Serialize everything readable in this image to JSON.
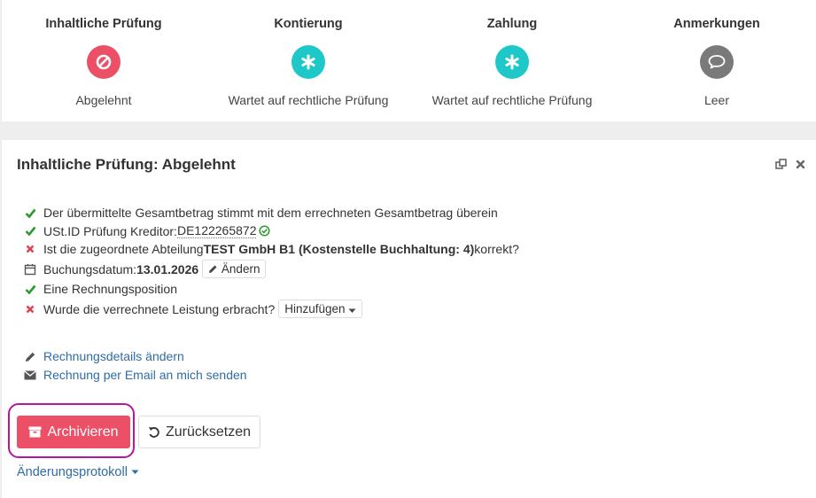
{
  "steps": [
    {
      "title": "Inhaltliche Prüfung",
      "status": "Abgelehnt",
      "icon": "ban-icon",
      "color": "#eb5066"
    },
    {
      "title": "Kontierung",
      "status": "Wartet auf rechtliche Prüfung",
      "icon": "asterisk-icon",
      "color": "#1fc8c8"
    },
    {
      "title": "Zahlung",
      "status": "Wartet auf rechtliche Prüfung",
      "icon": "asterisk-icon",
      "color": "#1fc8c8"
    },
    {
      "title": "Anmerkungen",
      "status": "Leer",
      "icon": "comment-icon",
      "color": "#7a7a7a"
    }
  ],
  "panel": {
    "title": "Inhaltliche Prüfung: Abgelehnt",
    "checks": {
      "total_match": "Der übermittelte Gesamtbetrag stimmt mit dem errechneten Gesamtbetrag überein",
      "ustid_label": "USt.ID Prüfung Kreditor: ",
      "ustid_value": "DE122265872",
      "dept_prefix": "Ist die zugeordnete Abteilung ",
      "dept_name": "TEST GmbH B1",
      "dept_cost": "(Kostenstelle Buchhaltung: 4)",
      "dept_suffix": " korrekt?",
      "date_label": "Buchungsdatum: ",
      "date_value": "13.01.2026",
      "date_button": "Ändern",
      "position": "Eine Rechnungsposition",
      "service_question": "Wurde die verrechnete Leistung erbracht?",
      "service_button": "Hinzufügen"
    },
    "links": {
      "edit_details": "Rechnungsdetails ändern",
      "send_email": "Rechnung per Email an mich senden"
    },
    "buttons": {
      "archive": "Archivieren",
      "reset": "Zurücksetzen"
    },
    "log_link": "Änderungsprotokoll"
  },
  "colors": {
    "ok": "#2d9a2d",
    "fail": "#e0404f",
    "link": "#2e6da4",
    "danger": "#eb5066",
    "highlight": "#b5179e"
  }
}
